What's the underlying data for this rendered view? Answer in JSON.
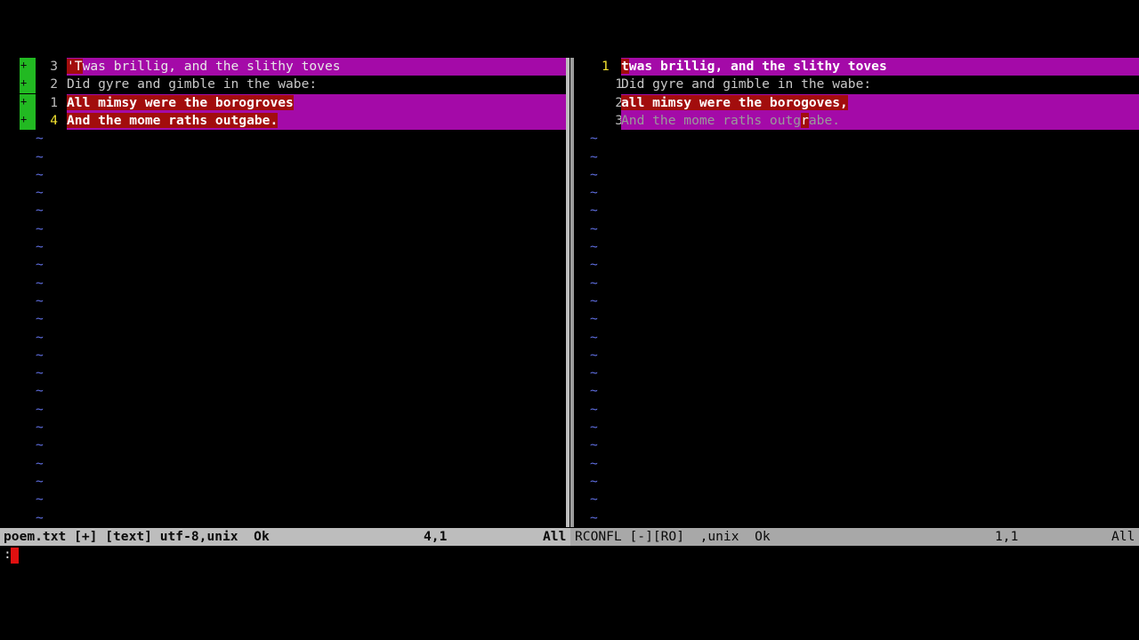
{
  "left_pane": {
    "lines": [
      {
        "sign": "+",
        "lnum": "3",
        "segments": [
          {
            "t": "'T",
            "dt": true
          },
          {
            "t": "was brillig, and the slithy toves",
            "dt": false
          }
        ],
        "style": "chg"
      },
      {
        "sign": "+",
        "lnum": "2",
        "segments": [
          {
            "t": "Did gyre and gimble in the wabe:",
            "dt": false
          }
        ],
        "style": "plain"
      },
      {
        "sign": "+",
        "lnum": "1",
        "segments": [
          {
            "t": "All mimsy were the borogroves",
            "dt": true
          }
        ],
        "style": "bold"
      },
      {
        "sign": "+",
        "lnum": "4",
        "segments": [
          {
            "t": "And the mome raths outgabe.",
            "dt": true
          }
        ],
        "style": "bold",
        "current": true
      }
    ],
    "filler": "~"
  },
  "right_pane": {
    "lines": [
      {
        "lnum": "1",
        "segments": [
          {
            "t": "twas brillig, and the slithy toves",
            "dt": false
          }
        ],
        "style": "bold",
        "current": true,
        "first_dt": true
      },
      {
        "lnum": "1",
        "segments": [
          {
            "t": "Did gyre and gimble in the wabe:",
            "dt": false
          }
        ],
        "style": "plain"
      },
      {
        "lnum": "2",
        "segments": [
          {
            "t": "all mimsy were the borogoves,",
            "dt": true
          }
        ],
        "style": "bold"
      },
      {
        "lnum": "3",
        "segments": [
          {
            "t": "And the mome raths outg",
            "dt": false
          },
          {
            "t": "r",
            "dt": true
          },
          {
            "t": "abe.",
            "dt": false
          }
        ],
        "style": "dim"
      }
    ],
    "filler": "~"
  },
  "status_left": {
    "file": "poem.txt [+] [text] utf-8,unix  Ok",
    "position": "4,1",
    "scroll": "All"
  },
  "status_right": {
    "file": "RCONFL [-][RO]  ,unix  Ok",
    "position": "1,1",
    "scroll": "All"
  },
  "cmdline": {
    "prompt": ":"
  },
  "colors": {
    "diff_change": "#a40aa8",
    "diff_text": "#a20d0d",
    "sign_add": "#22b922",
    "tilde": "#5f6ee0",
    "current_line_nr": "#f0e030"
  }
}
